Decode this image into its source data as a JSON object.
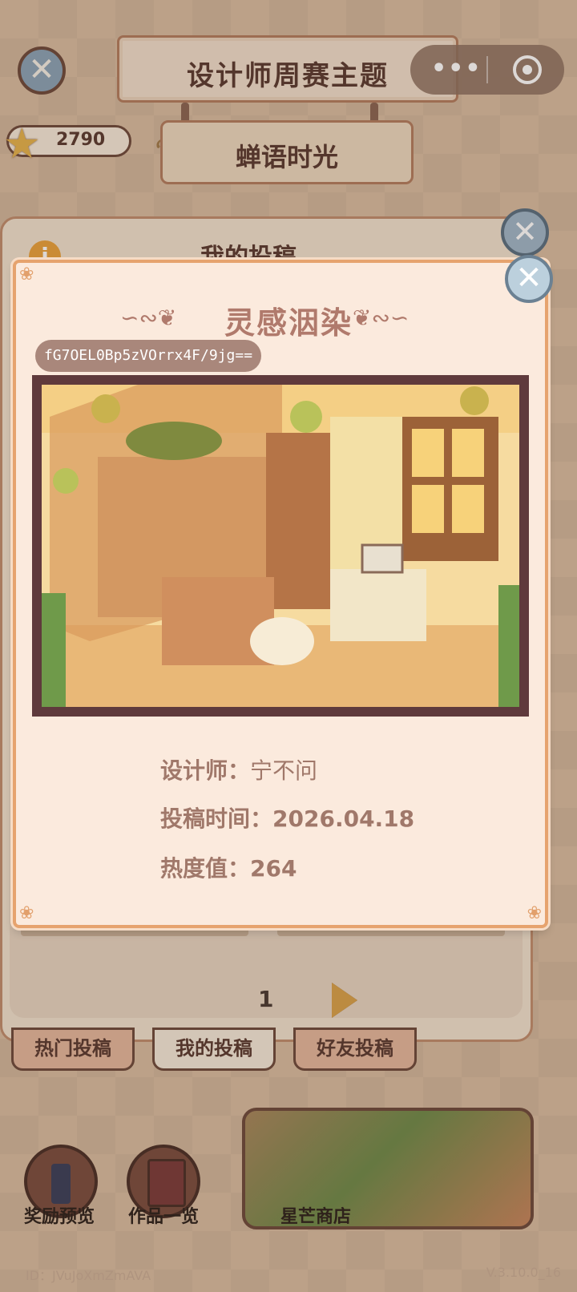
{
  "header": {
    "title": "设计师周赛主题",
    "subtitle": "蝉语时光",
    "star_count": "2790"
  },
  "back_panel": {
    "title": "我的投稿",
    "page_number": "1"
  },
  "modal": {
    "title": "灵感洇染",
    "id_code": "fG7OEL0Bp5zVOrrx4F/9jg==",
    "designer_label": "设计师：",
    "designer_value": "宁不问",
    "time_label": "投稿时间：",
    "time_value": "2026.04.18",
    "heat_label": "热度值：",
    "heat_value": "264"
  },
  "tabs": [
    {
      "label": "热门投稿"
    },
    {
      "label": "我的投稿"
    },
    {
      "label": "好友投稿"
    }
  ],
  "bottom": {
    "reward_label": "奖励预览",
    "works_label": "作品一览",
    "shop_label": "星芒商店"
  },
  "footer": {
    "user_id": "ID：JVuJoXmZmAVA",
    "version": "V.3.10.0_16"
  },
  "colors": {
    "accent": "#b07a6c",
    "modal_bg": "#fbeadd",
    "border": "#e6a36e"
  }
}
